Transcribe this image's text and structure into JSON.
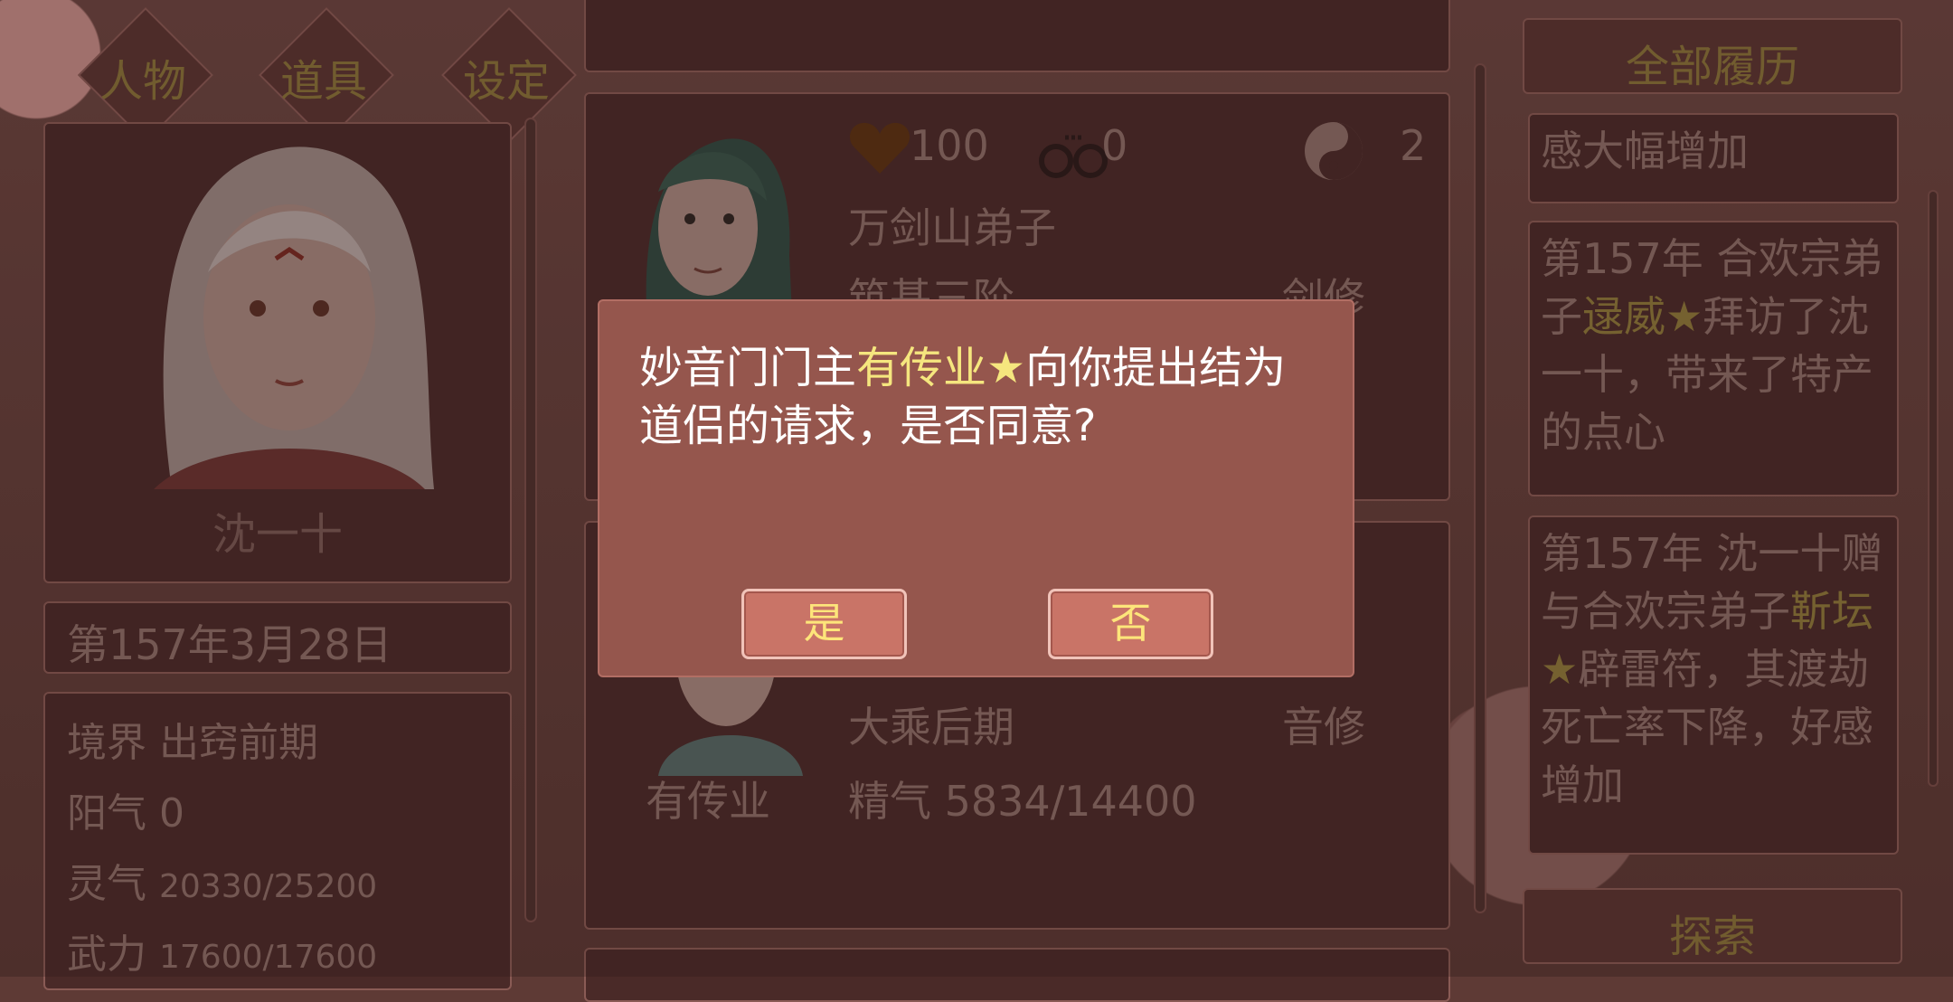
{
  "tabs": [
    {
      "label": "人物"
    },
    {
      "label": "道具"
    },
    {
      "label": "设定"
    }
  ],
  "player": {
    "name": "沈一十",
    "date": "第157年3月28日",
    "stats": [
      {
        "label": "境界",
        "value": "出窍前期"
      },
      {
        "label": "阳气",
        "value": "0"
      },
      {
        "label": "灵气",
        "value": "20330/25200"
      },
      {
        "label": "武力",
        "value": "17600/17600"
      }
    ]
  },
  "npc_card_1": {
    "heart_value": "100",
    "handcuff_value": "0",
    "yinyang_value": "2",
    "sect": "万剑山弟子",
    "realm": "筑基三阶",
    "class": "剑修"
  },
  "npc_card_2": {
    "realm": "大乘后期",
    "class": "音修",
    "name": "有传业",
    "essence": "精气 5834/14400"
  },
  "right_panel": {
    "header": "全部履历",
    "footer": "探索",
    "log_top_fragment": "感大幅增加",
    "logs": [
      {
        "pre": "第157年 合欢宗弟子",
        "highlight": "逯威★",
        "post": "拜访了沈一十，带来了特产的点心"
      },
      {
        "pre": "第157年 沈一十赠与合欢宗弟子",
        "highlight": "靳坛★",
        "post": "辟雷符，其渡劫死亡率下降，好感增加"
      }
    ]
  },
  "dialog": {
    "msg_pre": "妙音门门主",
    "msg_highlight": "有传业★",
    "msg_post": "向你提出结为道侣的请求，是否同意?",
    "yes_label": "是",
    "no_label": "否"
  }
}
